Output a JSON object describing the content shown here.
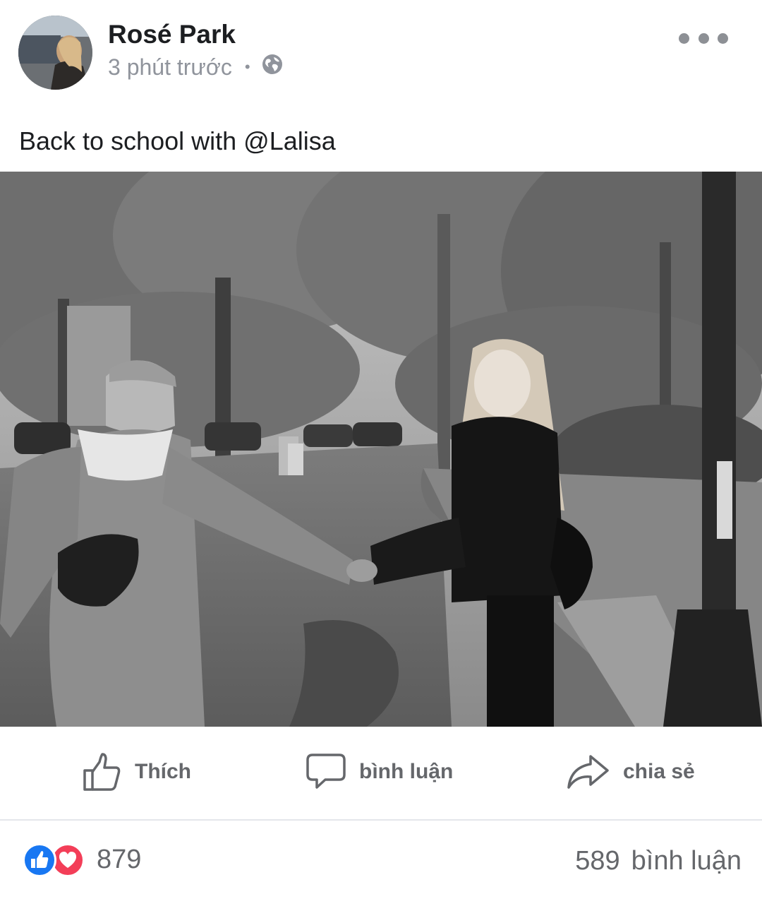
{
  "post": {
    "author": "Rosé Park",
    "time": "3 phút trước",
    "separator": "•",
    "caption": "Back to school with @Lalisa"
  },
  "actions": {
    "like": "Thích",
    "comment": "bình luận",
    "share": "chia sẻ"
  },
  "stats": {
    "reactions": "879",
    "comment_count": "589",
    "comment_label": "bình luận"
  },
  "icons": {
    "privacy": "globe-icon",
    "menu": "more-options-icon",
    "like": "thumbs-up-icon",
    "comment": "speech-bubble-icon",
    "share": "share-arrow-icon"
  },
  "colors": {
    "like_reaction": "#1877f2",
    "love_reaction": "#f33e58",
    "secondary_text": "#65676b"
  }
}
